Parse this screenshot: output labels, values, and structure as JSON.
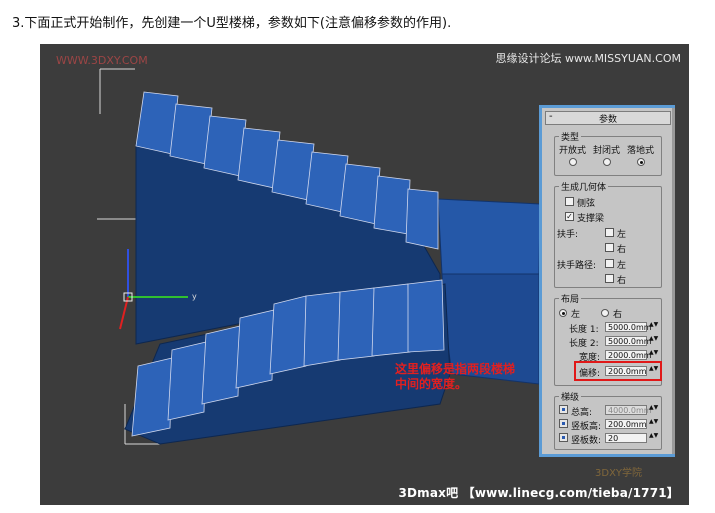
{
  "caption": "3.下面正式开始制作，先创建一个U型楼梯，参数如下(注意偏移参数的作用).",
  "watermark_tl": "WWW.3DXY.COM",
  "watermark_tr": "思缘设计论坛 www.MISSYUAN.COM",
  "watermark_br": "3Dmax吧 【www.linecg.com/tieba/1771】",
  "watermark_logo": "3DXY学院",
  "annotation": {
    "line1": "这里偏移是指两段楼梯",
    "line2": "中间的宽度。"
  },
  "axis_label": "y",
  "panel": {
    "minus": "-",
    "title": "参数",
    "type_group": {
      "label": "类型",
      "options": [
        "开放式",
        "封闭式",
        "落地式"
      ],
      "selected": 2
    },
    "geometry_group": {
      "label": "生成几何体",
      "stringers": {
        "label": "侧弦",
        "checked": false
      },
      "carriage": {
        "label": "支撑梁",
        "checked": true
      },
      "handrail_label": "扶手:",
      "handrail_path_label": "扶手路径:",
      "left": "左",
      "right": "右"
    },
    "layout_group": {
      "label": "布局",
      "left": "左",
      "right": "右",
      "length1_label": "长度 1:",
      "length1": "5000.0mm",
      "length2_label": "长度 2:",
      "length2": "5000.0mm",
      "width_label": "宽度:",
      "width": "2000.0mm",
      "offset_label": "偏移:",
      "offset": "200.0mm"
    },
    "steps_group": {
      "label": "梯级",
      "overall_label": "总高:",
      "overall": "4000.0mm",
      "riser_ht_label": "竖板高:",
      "riser_ht": "200.0mm",
      "riser_ct_label": "竖板数:",
      "riser_ct": "20"
    },
    "spin_arrows": "▲▼"
  },
  "colors": {
    "viewport": "#3c3c3c",
    "stair": "#1f4f94",
    "highlight": "#e01818",
    "panel_border": "#5b9bd5"
  }
}
